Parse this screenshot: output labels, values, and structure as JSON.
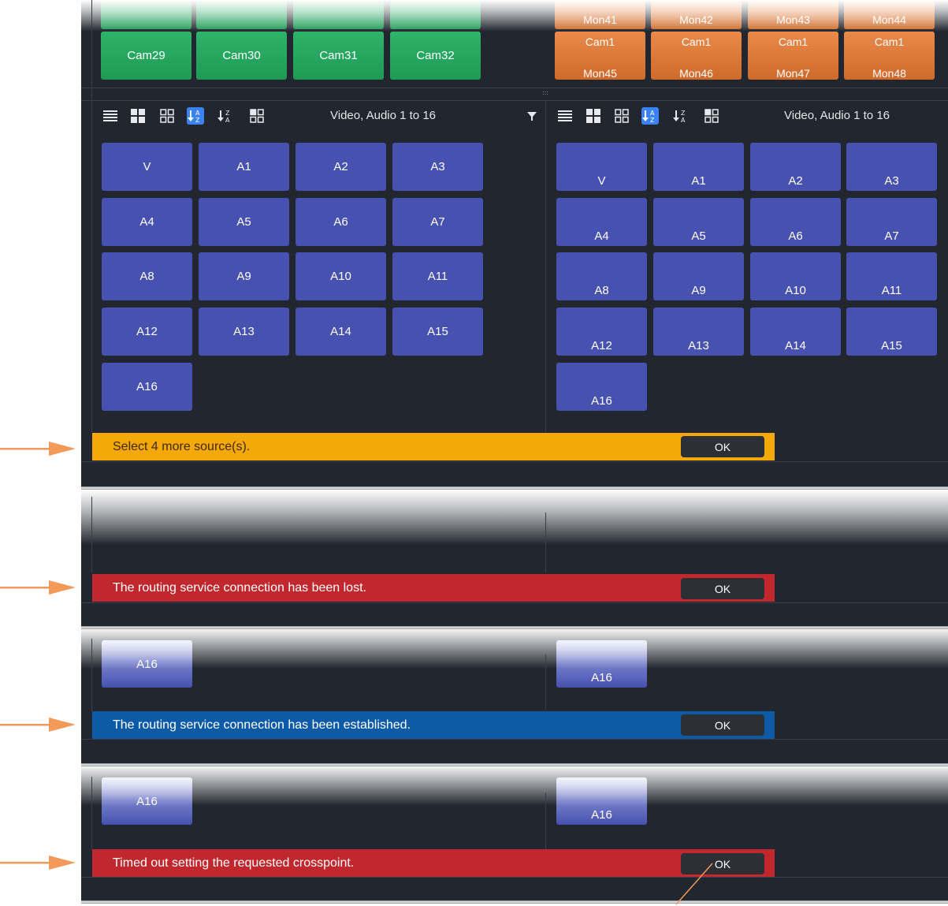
{
  "top_left_cams": [
    "Cam29",
    "Cam30",
    "Cam31",
    "Cam32"
  ],
  "top_right_mons_faded": [
    "Mon41",
    "Mon42",
    "Mon43",
    "Mon44"
  ],
  "top_right_tiles": [
    {
      "cam": "Cam1",
      "mon": "Mon45"
    },
    {
      "cam": "Cam1",
      "mon": "Mon46"
    },
    {
      "cam": "Cam1",
      "mon": "Mon47"
    },
    {
      "cam": "Cam1",
      "mon": "Mon48"
    }
  ],
  "toolbar": {
    "left_filter_label": "Video, Audio 1 to 16",
    "right_filter_label": "Video, Audio 1 to 16"
  },
  "channels": [
    "V",
    "A1",
    "A2",
    "A3",
    "A4",
    "A5",
    "A6",
    "A7",
    "A8",
    "A9",
    "A10",
    "A11",
    "A12",
    "A13",
    "A14",
    "A15",
    "A16"
  ],
  "messages": [
    {
      "text": "Select 4 more source(s).",
      "ok": "OK",
      "color": "#f5a80a"
    },
    {
      "text": "The routing service connection has been lost.",
      "ok": "OK",
      "color": "#c0282d"
    },
    {
      "text": "The routing service connection has been established.",
      "ok": "OK",
      "color": "#0d5aa7"
    },
    {
      "text": "Timed out setting the requested crosspoint.",
      "ok": "OK",
      "color": "#c0282d"
    }
  ],
  "snippet_tile_label": "A16",
  "colors": {
    "arrow": "#f39a5a",
    "panel_bg": "#22262e",
    "tile_blue": "#4651b0"
  }
}
